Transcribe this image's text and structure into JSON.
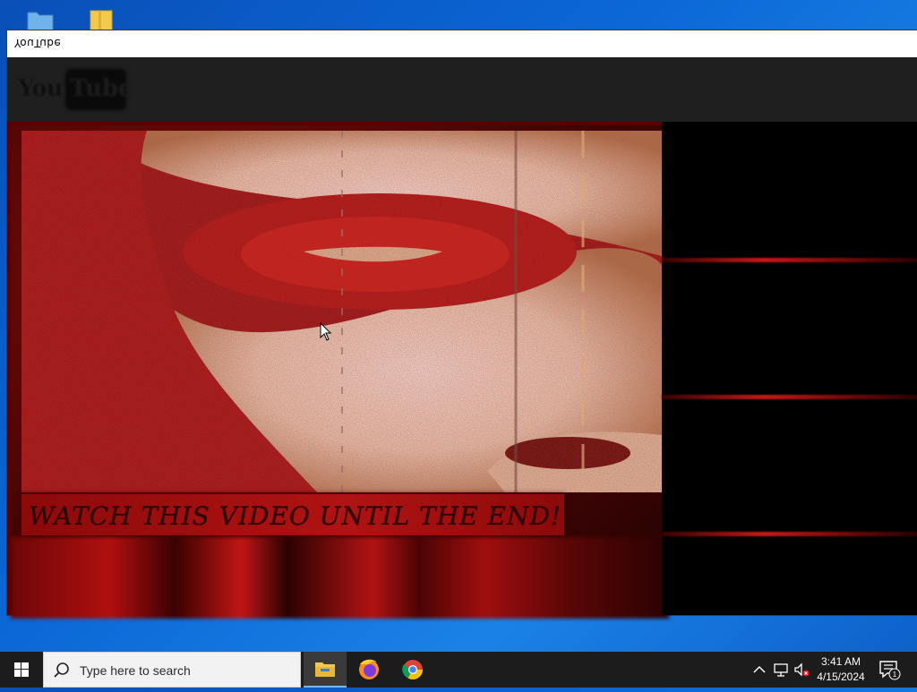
{
  "window": {
    "title": "YouTube"
  },
  "header": {
    "logo_you": "You",
    "logo_tube": "Tube"
  },
  "video": {
    "caption": "WATCH THIS VIDEO UNTIL THE END!"
  },
  "taskbar": {
    "search_placeholder": "Type here to search",
    "time": "3:41 AM",
    "date": "4/15/2024",
    "notification_count": "1"
  },
  "icons": {
    "start": "windows-start-icon",
    "search": "search-icon",
    "file_explorer": "file-explorer-icon",
    "firefox": "firefox-icon",
    "chrome": "chrome-icon",
    "chevron_up": "chevron-up-icon",
    "network": "network-icon",
    "volume": "volume-muted-icon",
    "notifications": "notifications-icon"
  },
  "colors": {
    "taskbar": "#1c1c1c",
    "accent_blue": "#76b9ed",
    "video_red": "#b01313",
    "header_dark": "#1f1f1f"
  }
}
